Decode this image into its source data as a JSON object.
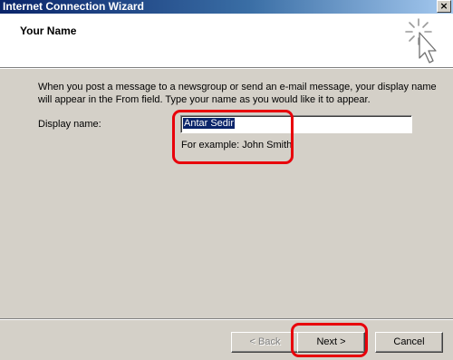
{
  "window": {
    "title": "Internet Connection Wizard",
    "close_glyph": "×"
  },
  "header": {
    "heading": "Your Name",
    "icon": "wizard-cursor-icon"
  },
  "body": {
    "description": "When you post a message to a newsgroup or send an e-mail message, your display name will appear in the From field.  Type your name as you would like it to appear.",
    "display_name_label": "Display name:",
    "display_name_value": "Antar Sedir",
    "example_text": "For example: John Smith"
  },
  "buttons": {
    "back": "< Back",
    "next": "Next >",
    "cancel": "Cancel"
  },
  "colors": {
    "title_bar": "#0a246a",
    "highlight": "#e8000b",
    "face": "#d4d0c8",
    "selection": "#0a246a"
  }
}
